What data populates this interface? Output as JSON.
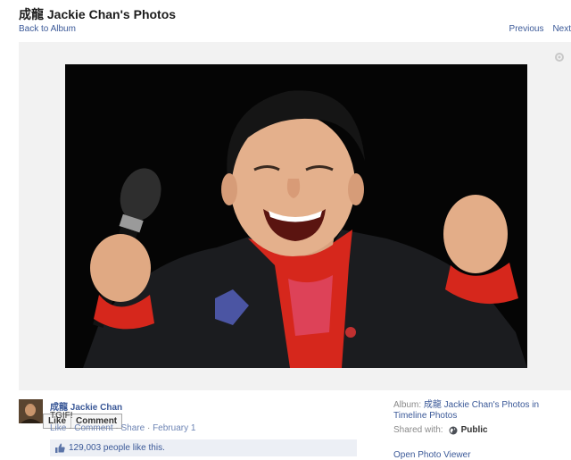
{
  "header": {
    "title": "成龍 Jackie Chan's Photos",
    "back_link": "Back to Album",
    "previous": "Previous",
    "next": "Next"
  },
  "photo_actions": {
    "like": "Like",
    "comment": "Comment"
  },
  "post": {
    "author": "成龍 Jackie Chan",
    "caption": "TGIF!",
    "like_link": "Like",
    "comment_link": "Comment",
    "share_link": "Share",
    "date": "February 1",
    "likes_text": "129,003 people like this."
  },
  "sidebar": {
    "album_label": "Album:",
    "album_name": "成龍 Jackie Chan's Photos in",
    "album_sub": "Timeline Photos",
    "shared_label": "Shared with:",
    "audience": "Public",
    "viewer_link": "Open Photo Viewer"
  },
  "icons": {
    "options": "options-icon",
    "thumbs_up": "thumbs-up-icon",
    "globe": "globe-icon"
  },
  "colors": {
    "link": "#3b5998",
    "likes_bg": "#eceff5",
    "stage_bg": "#f2f2f2"
  }
}
